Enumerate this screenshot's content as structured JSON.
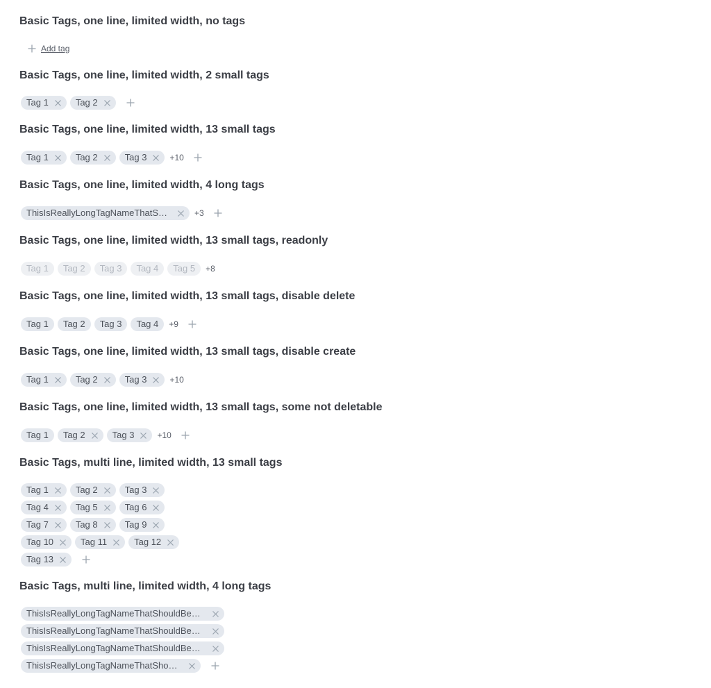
{
  "sections": [
    {
      "title": "Basic Tags, one line, limited width, no tags",
      "add_tag_label": "Add tag"
    },
    {
      "title": "Basic Tags, one line, limited width, 2 small tags",
      "tags": [
        "Tag 1",
        "Tag 2"
      ]
    },
    {
      "title": "Basic Tags, one line, limited width, 13 small tags",
      "tags": [
        "Tag 1",
        "Tag 2",
        "Tag 3"
      ],
      "more": "+10"
    },
    {
      "title": "Basic Tags, one line, limited width, 4 long tags",
      "tags": [
        "ThisIsReallyLongTagNameThatShouldBeTruncated"
      ],
      "more": "+3"
    },
    {
      "title": "Basic Tags, one line, limited width, 13 small tags, readonly",
      "tags": [
        "Tag 1",
        "Tag 2",
        "Tag 3",
        "Tag 4",
        "Tag 5"
      ],
      "more": "+8"
    },
    {
      "title": "Basic Tags, one line, limited width, 13 small tags, disable delete",
      "tags": [
        "Tag 1",
        "Tag 2",
        "Tag 3",
        "Tag 4"
      ],
      "more": "+9"
    },
    {
      "title": "Basic Tags, one line, limited width, 13 small tags, disable create",
      "tags": [
        "Tag 1",
        "Tag 2",
        "Tag 3"
      ],
      "more": "+10"
    },
    {
      "title": "Basic Tags, one line, limited width, 13 small tags, some not deletable",
      "tags": [
        "Tag 1",
        "Tag 2",
        "Tag 3"
      ],
      "more": "+10"
    },
    {
      "title": "Basic Tags, multi line, limited width, 13 small tags",
      "tags": [
        "Tag 1",
        "Tag 2",
        "Tag 3",
        "Tag 4",
        "Tag 5",
        "Tag 6",
        "Tag 7",
        "Tag 8",
        "Tag 9",
        "Tag 10",
        "Tag 11",
        "Tag 12",
        "Tag 13"
      ]
    },
    {
      "title": "Basic Tags, multi line, limited width, 4 long tags",
      "tags": [
        "ThisIsReallyLongTagNameThatShouldBeTruncated",
        "ThisIsReallyLongTagNameThatShouldBeTruncated",
        "ThisIsReallyLongTagNameThatShouldBeTruncated",
        "ThisIsReallyLongTagNameThatShouldBeTruncated"
      ]
    }
  ],
  "icons": {
    "remove": "close-icon",
    "add": "plus-icon"
  },
  "colors": {
    "tag_bg": "#e4e8ee",
    "tag_text": "#4d525a",
    "readonly_text": "#b3b8c0",
    "icon": "#9aa3ae",
    "title": "#3b3e45"
  }
}
